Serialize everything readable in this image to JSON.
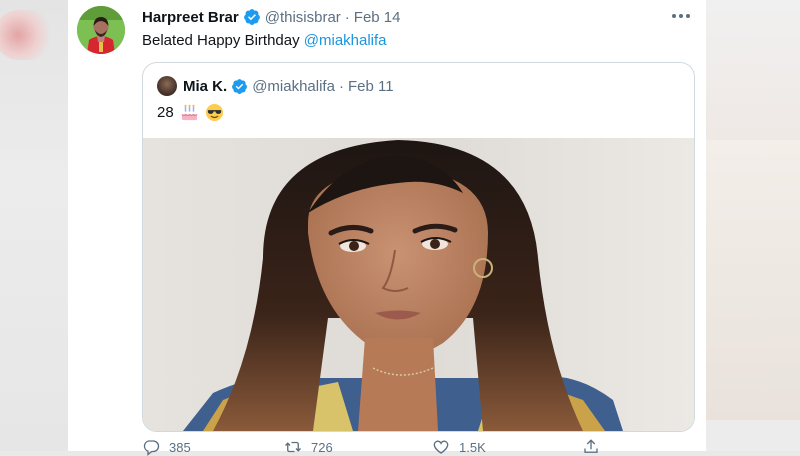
{
  "colors": {
    "text_primary": "#0f1419",
    "text_secondary": "#5b7083",
    "link": "#1b95e0",
    "verified": "#1d9bf0",
    "border": "#cfd9de"
  },
  "tweet": {
    "author_name": "Harpreet Brar",
    "handle": "@thisisbrar",
    "separator": "·",
    "date": "Feb 14",
    "verified_icon": "verified-badge-icon",
    "more_icon": "more-options-icon",
    "text_prefix": "Belated Happy Birthday ",
    "mention": "@miakhalifa"
  },
  "quoted_tweet": {
    "author_name": "Mia K.",
    "handle": "@miakhalifa",
    "separator": "·",
    "date": "Feb 11",
    "text": "28",
    "emojis": [
      "birthday-cake-emoji",
      "smiling-face-with-sunglasses-emoji"
    ],
    "verified_icon": "verified-badge-icon",
    "media": "selfie-photo"
  },
  "actions": [
    {
      "name": "reply",
      "icon": "reply-icon",
      "count": "385"
    },
    {
      "name": "retweet",
      "icon": "retweet-icon",
      "count": "726"
    },
    {
      "name": "like",
      "icon": "heart-icon",
      "count": "1.5K"
    },
    {
      "name": "share",
      "icon": "share-icon",
      "count": ""
    }
  ]
}
